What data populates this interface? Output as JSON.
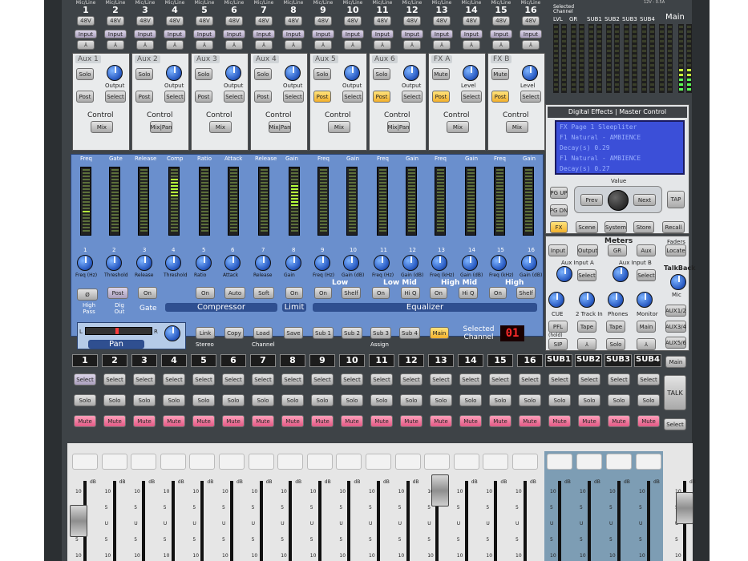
{
  "channels": [
    "1",
    "2",
    "3",
    "4",
    "5",
    "6",
    "7",
    "8",
    "9",
    "10",
    "11",
    "12",
    "13",
    "14",
    "15",
    "16"
  ],
  "channel_header": {
    "micline": "Mic/Line",
    "phantom": "48V",
    "input": "Input"
  },
  "power_label": "12V - 0.5A",
  "meters_header": {
    "selected_channel": "Selected Channel",
    "lvl": "LVL",
    "gr": "GR",
    "sub1": "SUB1",
    "sub2": "SUB2",
    "sub3": "SUB3",
    "sub4": "SUB4",
    "main": "Main"
  },
  "aux_panels": [
    {
      "title": "Aux 1",
      "b1": "Solo",
      "b2": "Post",
      "b3": "Select",
      "knob": "Output",
      "ctrl": "Control",
      "mix": "Mix"
    },
    {
      "title": "Aux 2",
      "b1": "Solo",
      "b2": "Post",
      "b3": "Select",
      "knob": "Output",
      "ctrl": "Control",
      "mix": "Mix|Pan"
    },
    {
      "title": "Aux 3",
      "b1": "Solo",
      "b2": "Post",
      "b3": "Select",
      "knob": "Output",
      "ctrl": "Control",
      "mix": "Mix"
    },
    {
      "title": "Aux 4",
      "b1": "Solo",
      "b2": "Post",
      "b3": "Select",
      "knob": "Output",
      "ctrl": "Control",
      "mix": "Mix|Pan"
    },
    {
      "title": "Aux 5",
      "b1": "Solo",
      "b2": "Post",
      "b3": "Select",
      "knob": "Output",
      "ctrl": "Control",
      "mix": "Mix"
    },
    {
      "title": "Aux 6",
      "b1": "Solo",
      "b2": "Post",
      "b3": "Select",
      "knob": "Output",
      "ctrl": "Control",
      "mix": "Mix|Pan"
    },
    {
      "title": "FX A",
      "b1": "Mute",
      "b2": "Post",
      "b3": "Select",
      "knob": "Level",
      "ctrl": "Control",
      "mix": "Mix"
    },
    {
      "title": "FX B",
      "b1": "Mute",
      "b2": "Post",
      "b3": "Select",
      "knob": "Level",
      "ctrl": "Control",
      "mix": "Mix"
    }
  ],
  "fx_panel": {
    "title": "Digital Effects | Master Control",
    "lcd": [
      "FX   Page 1 Sleepliter",
      "F1  Natural - AMBIENCE",
      "  Decay(s)      0.29",
      "F1  Natural - AMBIENCE",
      "  Decay(s)      0.27"
    ],
    "value": "Value",
    "prev": "Prev",
    "next": "Next",
    "tap": "TAP",
    "pgup": "PG UP",
    "pgdn": "PG DN",
    "fx": "FX",
    "scene": "Scene",
    "system": "System",
    "store": "Store",
    "recall": "Recall"
  },
  "strip": {
    "freq": "Freq",
    "gate": "Gate",
    "release": "Release",
    "comp": "Comp",
    "ratio": "Ratio",
    "attack": "Attack",
    "gain": "Gain",
    "num_labels": [
      "1",
      "2",
      "3",
      "4",
      "5",
      "6",
      "7",
      "8",
      "9",
      "10",
      "11",
      "12",
      "13",
      "14",
      "15",
      "16"
    ],
    "knob_labels": [
      "Freq (Hz)",
      "Threshold",
      "Release",
      "Threshold",
      "Ratio",
      "Attack",
      "Release",
      "Gain",
      "Freq (Hz)",
      "Gain (dB)",
      "Freq (Hz)",
      "Gain (dB)",
      "Freq (kHz)",
      "Gain (dB)",
      "Freq (kHz)",
      "Gain (dB)"
    ],
    "eq_bands": [
      "Low",
      "Low Mid",
      "High Mid",
      "High"
    ],
    "button_labels": [
      "On",
      "On",
      "Auto",
      "Soft",
      "On",
      "On",
      "Shelf",
      "On",
      "Hi Q",
      "On",
      "Hi Q",
      "On",
      "Shelf"
    ],
    "high_pass": "High Pass",
    "dig_out": "Dig Out",
    "post": "Post",
    "gate_title": "Gate",
    "compressor": "Compressor",
    "limit": "Limit",
    "equalizer": "Equalizer"
  },
  "row2": {
    "pan": "Pan",
    "link": "Link",
    "stereo": "Stereo",
    "copy": "Copy",
    "load": "Load",
    "save": "Save",
    "channel": "Channel",
    "sub1": "Sub 1",
    "sub2": "Sub 2",
    "sub3": "Sub 3",
    "sub4": "Sub 4",
    "main": "Main",
    "assign": "Assign",
    "selected_channel": "Selected Channel",
    "led_value": "01",
    "pan_l": "L",
    "pan_r": "R"
  },
  "master_controls": {
    "meters": "Meters",
    "faders": "Faders",
    "input": "Input",
    "output": "Output",
    "gr": "GR",
    "aux": "Aux",
    "locate": "Locate",
    "aux_a": "Aux Input A",
    "aux_b": "Aux Input B",
    "select": "Select",
    "talkback": "TalkBack",
    "mic": "Mic",
    "cue": "CUE",
    "two_track": "2 Track In",
    "phones": "Phones",
    "monitor": "Monitor",
    "pfl": "PFL",
    "tape": "Tape",
    "main": "Main",
    "hold": "(hold)",
    "sip": "SIP",
    "solo": "Solo",
    "aux12": "AUX1/2",
    "aux34": "AUX3/4",
    "aux56": "AUX5/6",
    "talk": "TALK"
  },
  "subs": [
    "SUB1",
    "SUB2",
    "SUB3",
    "SUB4"
  ],
  "channel_buttons": {
    "select": "Select",
    "solo": "Solo",
    "mute": "Mute"
  },
  "fader": {
    "db": "dB",
    "scale": [
      "10",
      "5",
      "U",
      "5",
      "10"
    ]
  },
  "colors": {
    "console": "#3e4347",
    "blue_panel": "#6a8fcd",
    "mute": "#e25a86",
    "post": "#f2b02d",
    "led": "#ff2b2b"
  }
}
